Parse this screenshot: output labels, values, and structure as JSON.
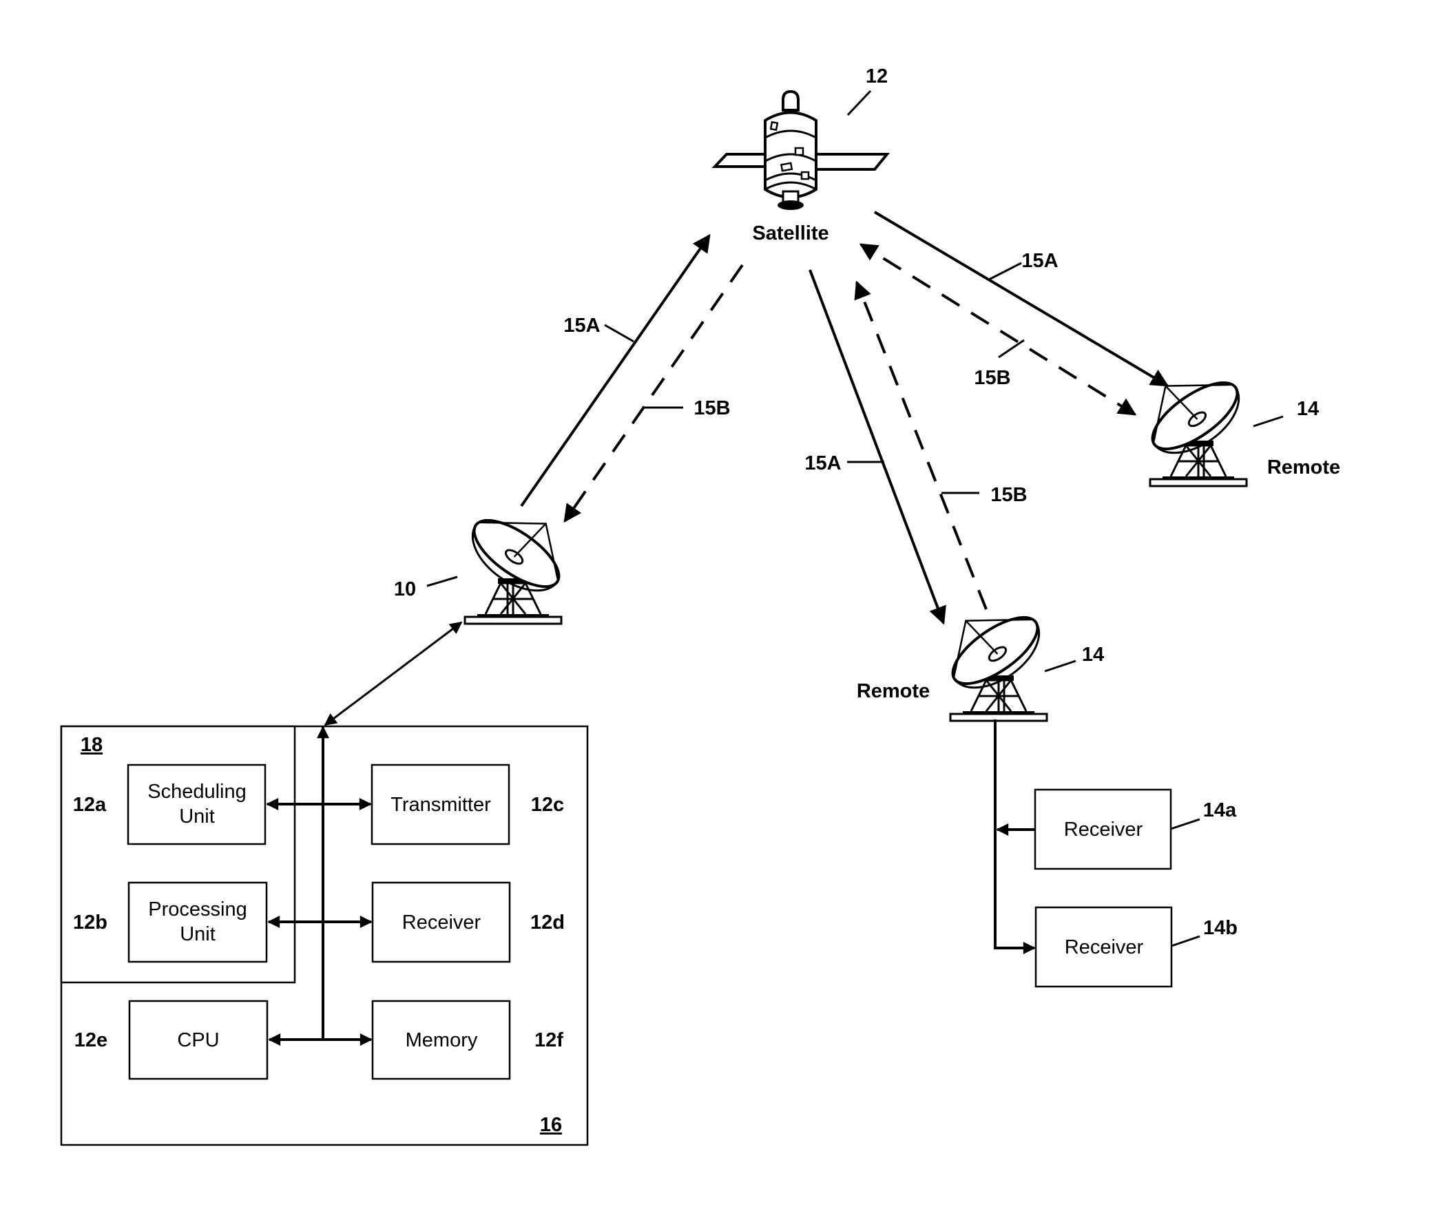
{
  "figure": {
    "satellite": {
      "label": "Satellite",
      "ref": "12"
    },
    "hub": {
      "ref": "10"
    },
    "remotes": [
      {
        "label": "Remote",
        "ref": "14"
      },
      {
        "label": "Remote",
        "ref": "14"
      }
    ],
    "links": {
      "forward": "15A",
      "return": "15B"
    },
    "hub_system": {
      "outer_ref": "16",
      "inner_ref": "18",
      "blocks": [
        {
          "ref": "12a",
          "lines": [
            "Scheduling",
            "Unit"
          ]
        },
        {
          "ref": "12b",
          "lines": [
            "Processing",
            "Unit"
          ]
        },
        {
          "ref": "12c",
          "lines": [
            "Transmitter"
          ]
        },
        {
          "ref": "12d",
          "lines": [
            "Receiver"
          ]
        },
        {
          "ref": "12e",
          "lines": [
            "CPU"
          ]
        },
        {
          "ref": "12f",
          "lines": [
            "Memory"
          ]
        }
      ]
    },
    "remote_receivers": [
      {
        "ref": "14a",
        "label": "Receiver"
      },
      {
        "ref": "14b",
        "label": "Receiver"
      }
    ]
  }
}
